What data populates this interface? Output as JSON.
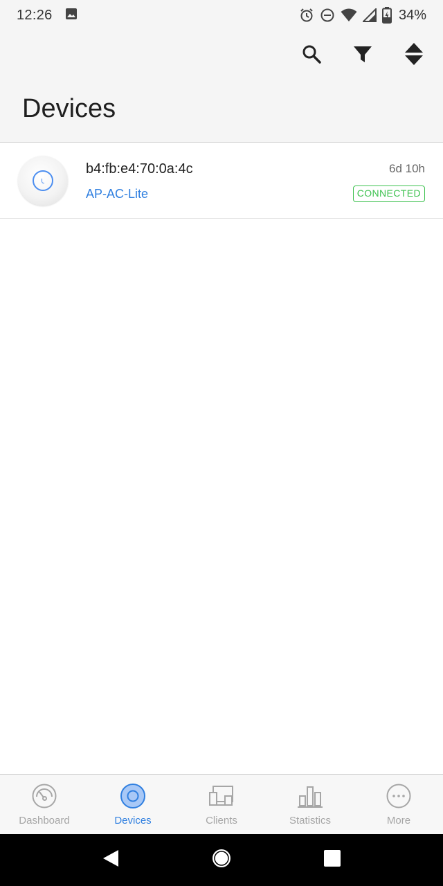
{
  "status_bar": {
    "time": "12:26",
    "battery": "34%",
    "icons": [
      "image-icon",
      "alarm-icon",
      "do-not-disturb-icon",
      "wifi-icon",
      "cell-signal-icon",
      "battery-charging-icon"
    ]
  },
  "app_bar": {
    "title": "Devices",
    "actions": [
      "search-icon",
      "filter-icon",
      "sort-icon"
    ]
  },
  "devices": [
    {
      "mac": "b4:fb:e4:70:0a:4c",
      "model": "AP-AC-Lite",
      "uptime": "6d 10h",
      "status": "CONNECTED"
    }
  ],
  "bottom_nav": {
    "active": "Devices",
    "items": [
      {
        "label": "Dashboard",
        "icon": "dashboard-icon"
      },
      {
        "label": "Devices",
        "icon": "devices-icon"
      },
      {
        "label": "Clients",
        "icon": "clients-icon"
      },
      {
        "label": "Statistics",
        "icon": "statistics-icon"
      },
      {
        "label": "More",
        "icon": "more-icon"
      }
    ]
  },
  "system_nav": [
    "back-icon",
    "home-icon",
    "recents-icon"
  ],
  "colors": {
    "accent": "#2f7fe0",
    "connected": "#3cc14e",
    "inactive": "#a6a6a6"
  }
}
